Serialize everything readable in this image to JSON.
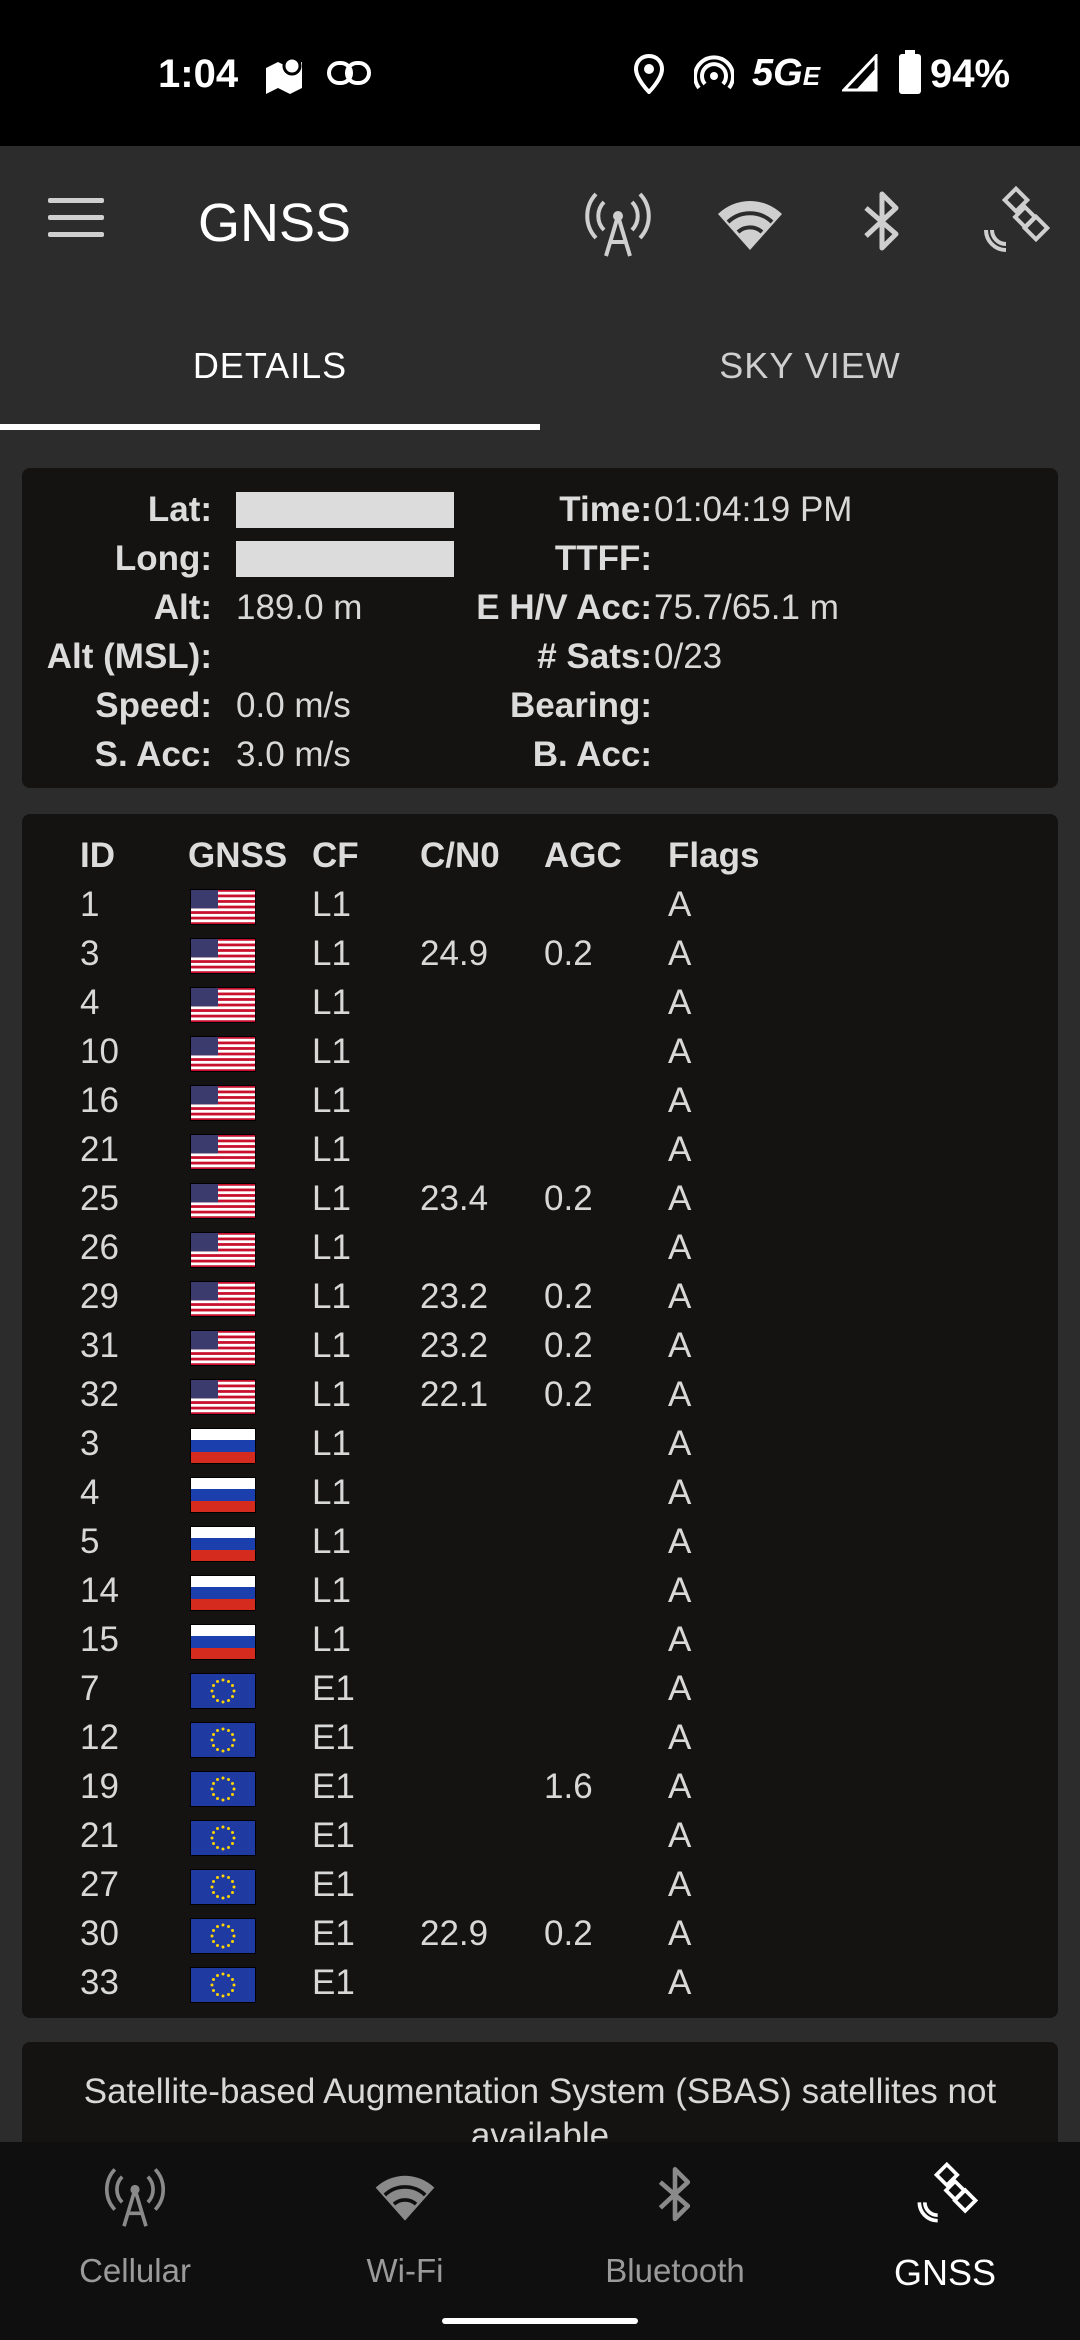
{
  "status_bar": {
    "time": "1:04",
    "network": "5G",
    "network_suffix": "E",
    "battery": "94%",
    "icons": [
      "map-notification-icon",
      "link-icon",
      "location-icon",
      "hotspot-icon",
      "signal-icon",
      "battery-icon"
    ]
  },
  "app_bar": {
    "title": "GNSS",
    "actions": [
      "cellular-icon",
      "wifi-icon",
      "bluetooth-icon",
      "satellite-icon"
    ]
  },
  "tabs": [
    {
      "label": "DETAILS",
      "selected": true
    },
    {
      "label": "SKY VIEW",
      "selected": false
    }
  ],
  "location": {
    "lat_label": "Lat:",
    "lat": "",
    "long_label": "Long:",
    "long": "",
    "alt_label": "Alt:",
    "alt": "189.0 m",
    "alt_msl_label": "Alt (MSL):",
    "alt_msl": "",
    "speed_label": "Speed:",
    "speed": "0.0 m/s",
    "s_acc_label": "S. Acc:",
    "s_acc": "3.0 m/s",
    "time_label": "Time:",
    "time": "01:04:19 PM",
    "ttff_label": "TTFF:",
    "ttff": "",
    "ehv_acc_label": "E H/V Acc:",
    "ehv_acc": "75.7/65.1 m",
    "sats_label": "# Sats:",
    "sats": "0/23",
    "bearing_label": "Bearing:",
    "bearing": "",
    "b_acc_label": "B. Acc:",
    "b_acc": ""
  },
  "satellites": {
    "headers": {
      "id": "ID",
      "gnss": "GNSS",
      "cf": "CF",
      "cn0": "C/N0",
      "agc": "AGC",
      "flags": "Flags"
    },
    "rows": [
      {
        "id": "1",
        "gnss": "us-flag-icon",
        "cf": "L1",
        "cn0": "",
        "agc": "",
        "flags": "A"
      },
      {
        "id": "3",
        "gnss": "us-flag-icon",
        "cf": "L1",
        "cn0": "24.9",
        "agc": "0.2",
        "flags": "A"
      },
      {
        "id": "4",
        "gnss": "us-flag-icon",
        "cf": "L1",
        "cn0": "",
        "agc": "",
        "flags": "A"
      },
      {
        "id": "10",
        "gnss": "us-flag-icon",
        "cf": "L1",
        "cn0": "",
        "agc": "",
        "flags": "A"
      },
      {
        "id": "16",
        "gnss": "us-flag-icon",
        "cf": "L1",
        "cn0": "",
        "agc": "",
        "flags": "A"
      },
      {
        "id": "21",
        "gnss": "us-flag-icon",
        "cf": "L1",
        "cn0": "",
        "agc": "",
        "flags": "A"
      },
      {
        "id": "25",
        "gnss": "us-flag-icon",
        "cf": "L1",
        "cn0": "23.4",
        "agc": "0.2",
        "flags": "A"
      },
      {
        "id": "26",
        "gnss": "us-flag-icon",
        "cf": "L1",
        "cn0": "",
        "agc": "",
        "flags": "A"
      },
      {
        "id": "29",
        "gnss": "us-flag-icon",
        "cf": "L1",
        "cn0": "23.2",
        "agc": "0.2",
        "flags": "A"
      },
      {
        "id": "31",
        "gnss": "us-flag-icon",
        "cf": "L1",
        "cn0": "23.2",
        "agc": "0.2",
        "flags": "A"
      },
      {
        "id": "32",
        "gnss": "us-flag-icon",
        "cf": "L1",
        "cn0": "22.1",
        "agc": "0.2",
        "flags": "A"
      },
      {
        "id": "3",
        "gnss": "russia-flag-icon",
        "cf": "L1",
        "cn0": "",
        "agc": "",
        "flags": "A"
      },
      {
        "id": "4",
        "gnss": "russia-flag-icon",
        "cf": "L1",
        "cn0": "",
        "agc": "",
        "flags": "A"
      },
      {
        "id": "5",
        "gnss": "russia-flag-icon",
        "cf": "L1",
        "cn0": "",
        "agc": "",
        "flags": "A"
      },
      {
        "id": "14",
        "gnss": "russia-flag-icon",
        "cf": "L1",
        "cn0": "",
        "agc": "",
        "flags": "A"
      },
      {
        "id": "15",
        "gnss": "russia-flag-icon",
        "cf": "L1",
        "cn0": "",
        "agc": "",
        "flags": "A"
      },
      {
        "id": "7",
        "gnss": "eu-flag-icon",
        "cf": "E1",
        "cn0": "",
        "agc": "",
        "flags": "A"
      },
      {
        "id": "12",
        "gnss": "eu-flag-icon",
        "cf": "E1",
        "cn0": "",
        "agc": "",
        "flags": "A"
      },
      {
        "id": "19",
        "gnss": "eu-flag-icon",
        "cf": "E1",
        "cn0": "",
        "agc": "1.6",
        "flags": "A"
      },
      {
        "id": "21",
        "gnss": "eu-flag-icon",
        "cf": "E1",
        "cn0": "",
        "agc": "",
        "flags": "A"
      },
      {
        "id": "27",
        "gnss": "eu-flag-icon",
        "cf": "E1",
        "cn0": "",
        "agc": "",
        "flags": "A"
      },
      {
        "id": "30",
        "gnss": "eu-flag-icon",
        "cf": "E1",
        "cn0": "22.9",
        "agc": "0.2",
        "flags": "A"
      },
      {
        "id": "33",
        "gnss": "eu-flag-icon",
        "cf": "E1",
        "cn0": "",
        "agc": "",
        "flags": "A"
      }
    ]
  },
  "sbas": {
    "message": "Satellite-based Augmentation System (SBAS) satellites not available"
  },
  "bottom_nav": [
    {
      "label": "Cellular",
      "icon": "cellular-icon",
      "active": false
    },
    {
      "label": "Wi-Fi",
      "icon": "wifi-icon",
      "active": false
    },
    {
      "label": "Bluetooth",
      "icon": "bluetooth-icon",
      "active": false
    },
    {
      "label": "GNSS",
      "icon": "satellite-icon",
      "active": true
    }
  ],
  "colors": {
    "background": "#2c2c2c",
    "card": "#141312",
    "status_bar": "#000000",
    "bottom_nav": "#0f0f0f",
    "text": "#e6e6e6"
  }
}
